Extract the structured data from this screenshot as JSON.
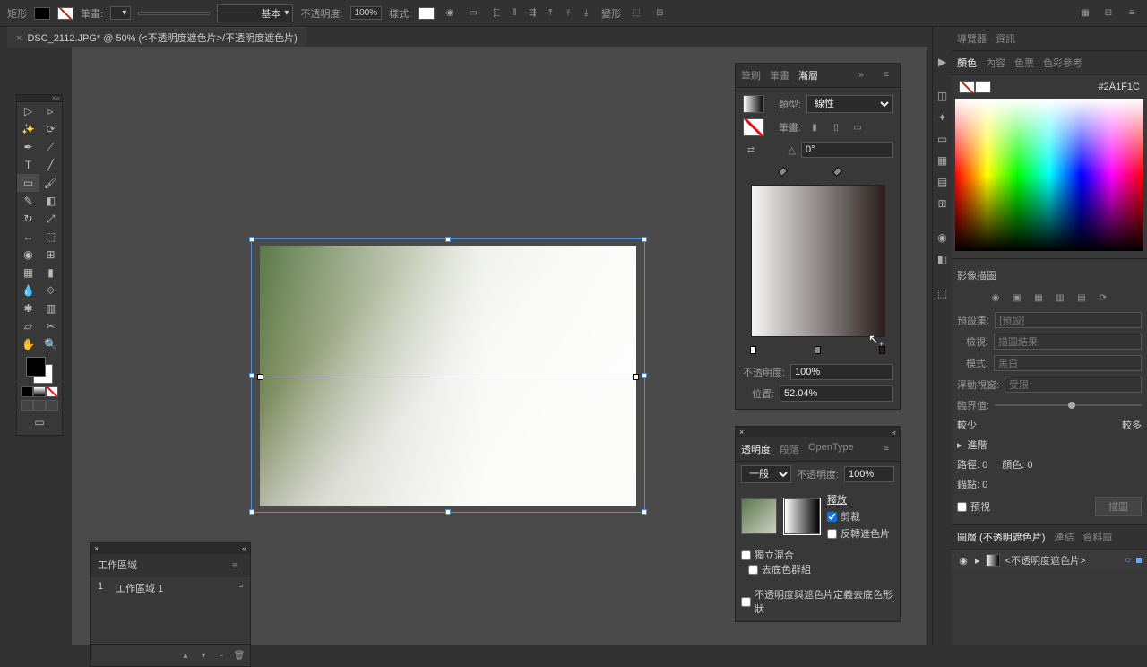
{
  "topbar": {
    "tool_label": "矩形",
    "stroke_label": "筆畫:",
    "stroke_style": "基本",
    "opacity_label": "不透明度:",
    "opacity_value": "100%",
    "style_label": "樣式:",
    "transform_label": "變形"
  },
  "document": {
    "tab_title": "DSC_2112.JPG* @ 50% (<不透明度遮色片>/不透明度遮色片)"
  },
  "gradient_panel": {
    "tabs": [
      "筆刷",
      "筆畫",
      "漸層"
    ],
    "type_label": "類型:",
    "type_value": "線性",
    "stroke_label": "筆畫:",
    "angle_value": "0°",
    "opacity_label": "不透明度:",
    "opacity_value": "100%",
    "position_label": "位置:",
    "position_value": "52.04%"
  },
  "transparency_panel": {
    "tabs": [
      "透明度",
      "段落",
      "OpenType"
    ],
    "mode": "一般",
    "opacity_label": "不透明度:",
    "opacity_value": "100%",
    "release": "釋放",
    "clip": "剪裁",
    "invert": "反轉遮色片",
    "isolate": "獨立混合",
    "knockout": "去底色群組",
    "define": "不透明度與遮色片定義去底色形狀"
  },
  "artboard_panel": {
    "title": "工作區域",
    "items": [
      {
        "num": "1",
        "name": "工作區域 1"
      }
    ]
  },
  "right_panel": {
    "nav_tabs": [
      "導覽器",
      "資訊"
    ],
    "color_tabs": [
      "顏色",
      "內容",
      "色票",
      "色彩參考"
    ],
    "hex_value": "2A1F1C",
    "trace_title": "影像描圖",
    "preset_label": "預設集:",
    "preset_value": "[預設]",
    "view_label": "檢視:",
    "view_value": "描圖結果",
    "mode_label": "模式:",
    "mode_value": "黑白",
    "float_label": "浮動視窗:",
    "float_value": "受限",
    "threshold_label": "臨界值:",
    "less": "較少",
    "more": "較多",
    "advanced": "進階",
    "paths_label": "路徑:",
    "paths_value": "0",
    "colors_label": "顏色:",
    "colors_value": "0",
    "anchors_label": "錨點:",
    "anchors_value": "0",
    "preview": "預視",
    "trace_btn": "描圖",
    "layer_tabs": [
      "圖層 (不透明遮色片)",
      "連結",
      "資料庫"
    ],
    "layer_name": "<不透明度遮色片>"
  }
}
